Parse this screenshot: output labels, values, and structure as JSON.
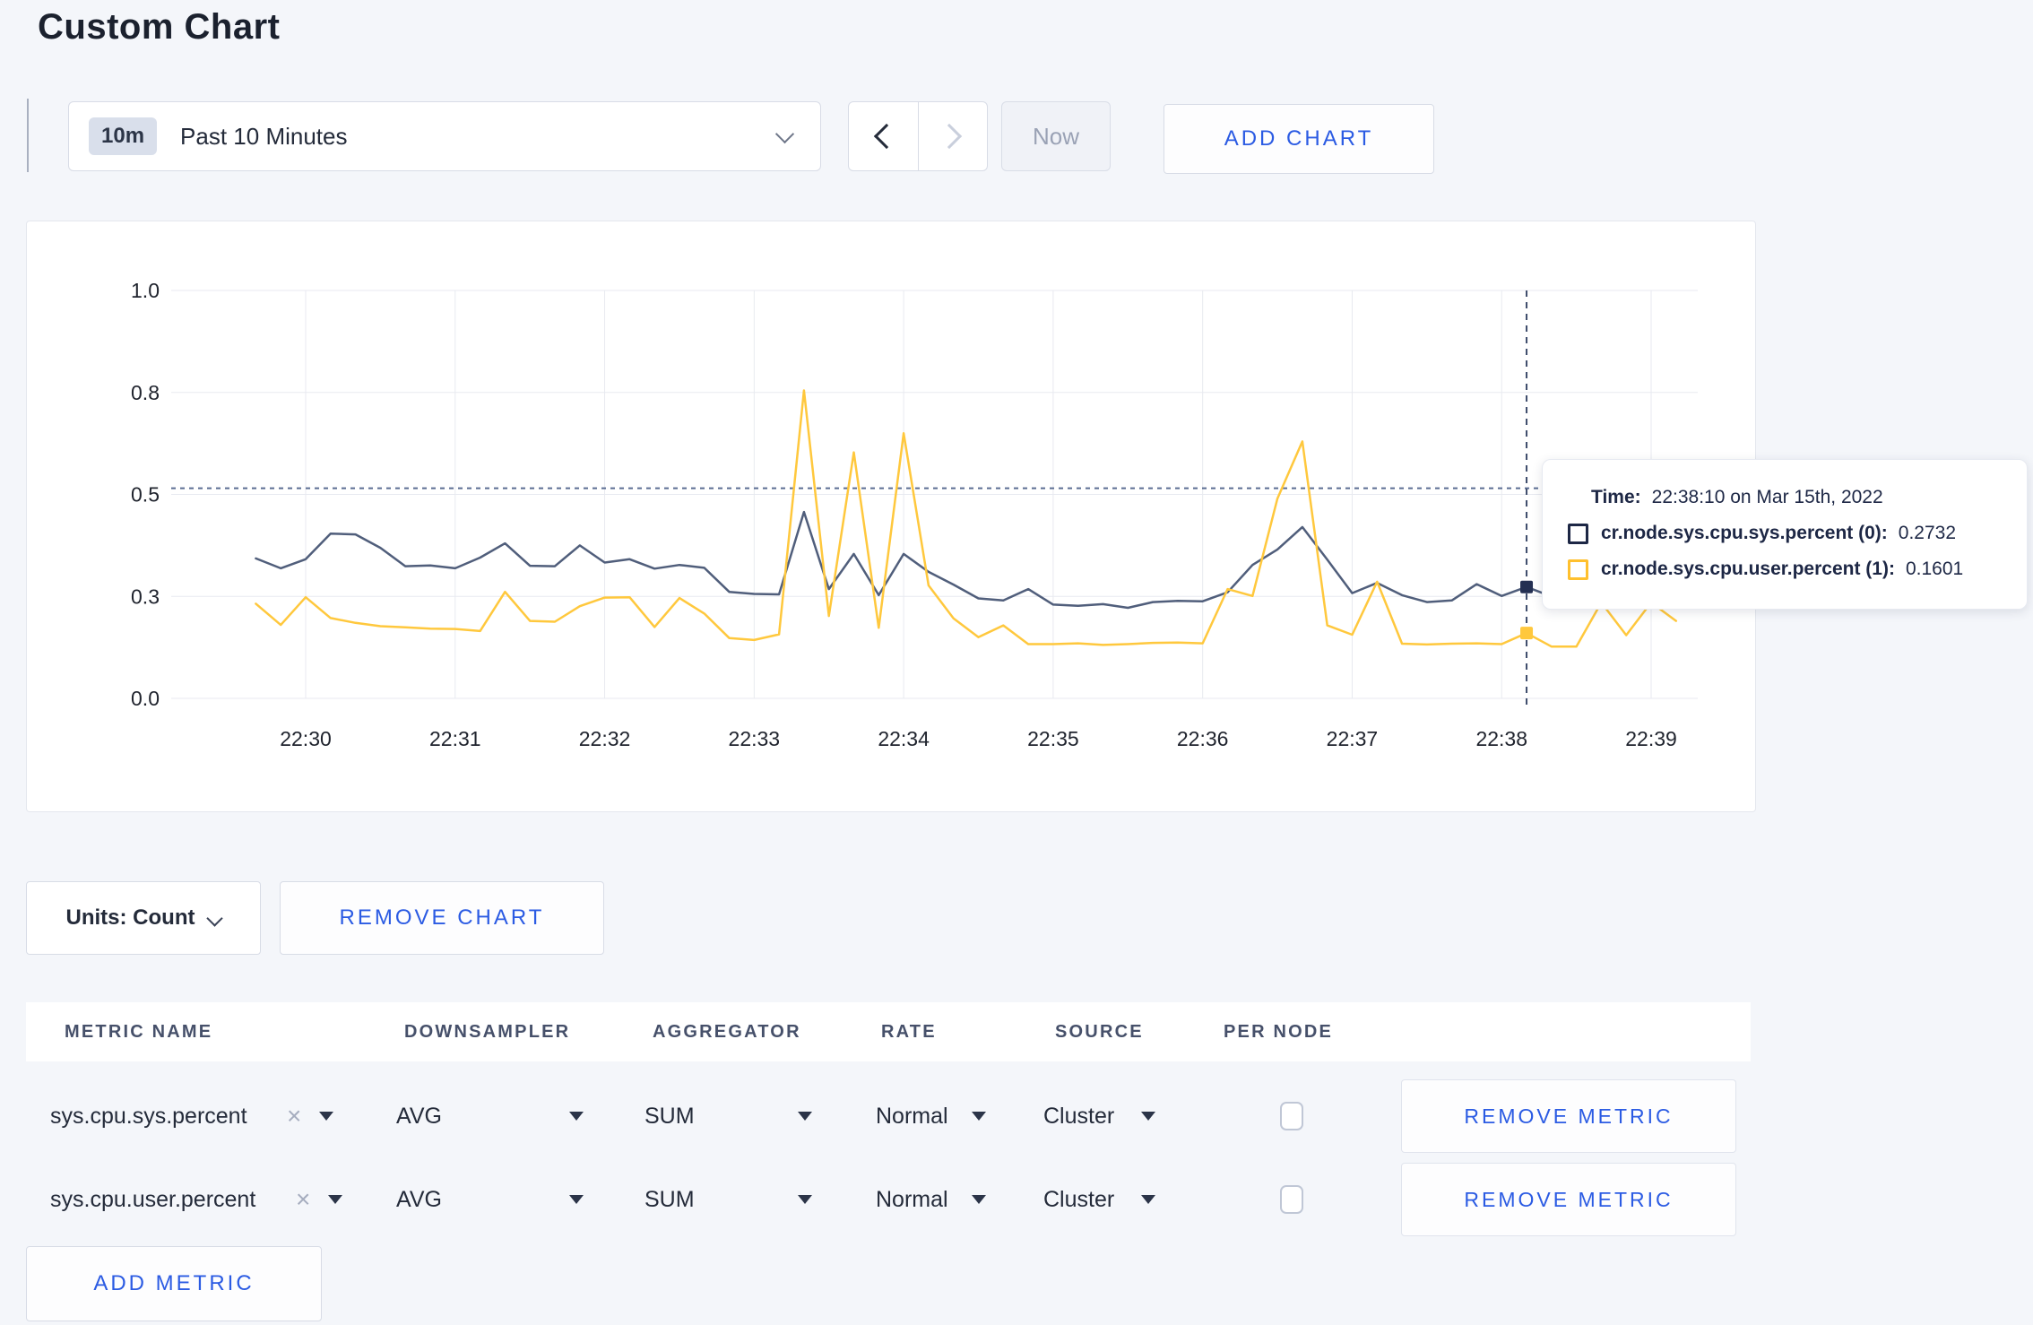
{
  "page": {
    "title": "Custom Chart"
  },
  "toolbar": {
    "time_range_badge": "10m",
    "time_range_label": "Past 10 Minutes",
    "now_label": "Now",
    "add_chart_label": "ADD CHART"
  },
  "tooltip": {
    "time_label": "Time:",
    "time_value": "22:38:10 on Mar 15th, 2022",
    "entries": [
      {
        "label": "cr.node.sys.cpu.sys.percent (0):",
        "value": "0.2732",
        "color": "#1d2745"
      },
      {
        "label": "cr.node.sys.cpu.user.percent (1):",
        "value": "0.1601",
        "color": "#ffc02e"
      }
    ]
  },
  "chart_controls": {
    "units_label": "Units: Count",
    "remove_chart_label": "REMOVE CHART"
  },
  "metrics_table": {
    "headers": [
      "METRIC NAME",
      "DOWNSAMPLER",
      "AGGREGATOR",
      "RATE",
      "SOURCE",
      "PER NODE"
    ],
    "rows": [
      {
        "metric_name": "sys.cpu.sys.percent",
        "downsampler": "AVG",
        "aggregator": "SUM",
        "rate": "Normal",
        "source": "Cluster",
        "per_node_checked": false,
        "remove_label": "REMOVE METRIC"
      },
      {
        "metric_name": "sys.cpu.user.percent",
        "downsampler": "AVG",
        "aggregator": "SUM",
        "rate": "Normal",
        "source": "Cluster",
        "per_node_checked": false,
        "remove_label": "REMOVE METRIC"
      }
    ],
    "add_metric_label": "ADD METRIC"
  },
  "chart_data": {
    "type": "line",
    "title": "",
    "xlabel": "",
    "ylabel": "",
    "ylim": [
      0,
      1
    ],
    "grid": true,
    "x_tick_labels": [
      "22:30",
      "22:31",
      "22:32",
      "22:33",
      "22:34",
      "22:35",
      "22:36",
      "22:37",
      "22:38",
      "22:39"
    ],
    "y_tick_labels": [
      "0.0",
      "0.3",
      "0.5",
      "0.8",
      "1.0"
    ],
    "y_tick_values": [
      0,
      0.25,
      0.5,
      0.75,
      1.0
    ],
    "threshold_value": 0.515,
    "crosshair_time": "22:38:10",
    "sample_interval_seconds": 10,
    "start_time": "22:29:40",
    "series": [
      {
        "name": "cr.node.sys.cpu.sys.percent (0)",
        "color": "#505e7b",
        "marker_color": "#232f52",
        "marker_time": "22:38:10",
        "marker_value": 0.2732,
        "values": [
          0.343,
          0.319,
          0.341,
          0.404,
          0.402,
          0.369,
          0.324,
          0.326,
          0.319,
          0.345,
          0.38,
          0.325,
          0.324,
          0.375,
          0.333,
          0.341,
          0.318,
          0.327,
          0.32,
          0.261,
          0.256,
          0.255,
          0.457,
          0.268,
          0.354,
          0.253,
          0.354,
          0.31,
          0.279,
          0.245,
          0.24,
          0.268,
          0.23,
          0.227,
          0.231,
          0.222,
          0.236,
          0.239,
          0.238,
          0.26,
          0.327,
          0.365,
          0.42,
          0.34,
          0.258,
          0.283,
          0.253,
          0.236,
          0.24,
          0.28,
          0.251,
          0.2732,
          0.25,
          0.27,
          0.28,
          0.27,
          0.28,
          0.28
        ]
      },
      {
        "name": "cr.node.sys.cpu.user.percent (1)",
        "color": "#ffc83d",
        "marker_color": "#ffc83d",
        "marker_time": "22:38:10",
        "marker_value": 0.1601,
        "values": [
          0.232,
          0.18,
          0.248,
          0.197,
          0.185,
          0.177,
          0.174,
          0.171,
          0.17,
          0.165,
          0.261,
          0.19,
          0.188,
          0.226,
          0.247,
          0.248,
          0.175,
          0.246,
          0.208,
          0.148,
          0.143,
          0.157,
          0.755,
          0.202,
          0.603,
          0.173,
          0.65,
          0.277,
          0.196,
          0.15,
          0.179,
          0.133,
          0.133,
          0.135,
          0.131,
          0.133,
          0.136,
          0.137,
          0.135,
          0.268,
          0.251,
          0.49,
          0.63,
          0.179,
          0.156,
          0.286,
          0.134,
          0.132,
          0.134,
          0.135,
          0.133,
          0.1601,
          0.127,
          0.127,
          0.235,
          0.155,
          0.235,
          0.19
        ]
      }
    ]
  }
}
